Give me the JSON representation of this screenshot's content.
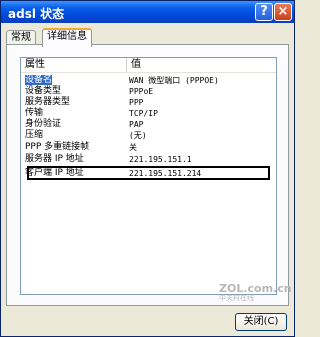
{
  "window": {
    "title": "adsl 状态",
    "help_glyph": "?",
    "close_glyph": "×"
  },
  "tabs": [
    {
      "label": "常规"
    },
    {
      "label": "详细信息"
    }
  ],
  "list": {
    "headers": {
      "property": "属性",
      "value": "值"
    },
    "rows": [
      {
        "property": "设备名",
        "value": "WAN 微型端口 (PPPOE)"
      },
      {
        "property": "设备类型",
        "value": "PPPoE"
      },
      {
        "property": "服务器类型",
        "value": "PPP"
      },
      {
        "property": "传输",
        "value": "TCP/IP"
      },
      {
        "property": "身份验证",
        "value": "PAP"
      },
      {
        "property": "压缩",
        "value": "(无)"
      },
      {
        "property": "PPP 多重链接帧",
        "value": "关"
      },
      {
        "property": "服务器 IP 地址",
        "value": "221.195.151.1"
      },
      {
        "property": "客户端 IP 地址",
        "value": "221.195.151.214"
      }
    ]
  },
  "footer": {
    "close_label": "关闭(C)"
  },
  "watermark": {
    "text": "ZOL.com.cn",
    "subtext": "中关村在线"
  }
}
